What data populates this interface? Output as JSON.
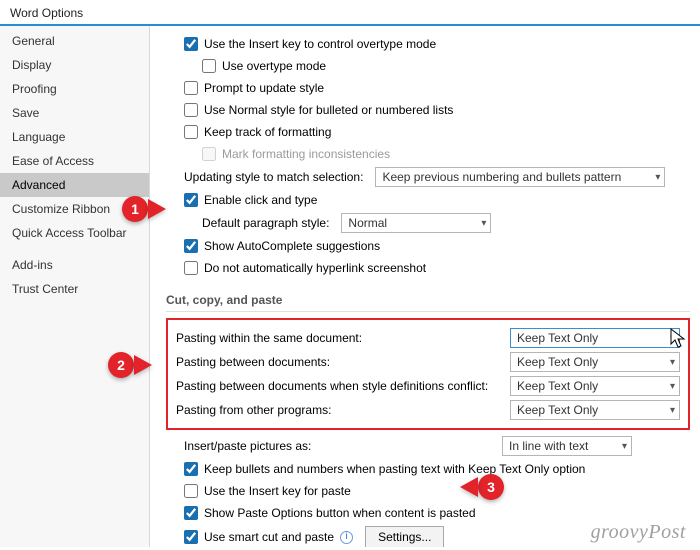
{
  "window": {
    "title": "Word Options"
  },
  "sidebar": {
    "items": [
      {
        "label": "General"
      },
      {
        "label": "Display"
      },
      {
        "label": "Proofing"
      },
      {
        "label": "Save"
      },
      {
        "label": "Language"
      },
      {
        "label": "Ease of Access"
      },
      {
        "label": "Advanced",
        "selected": true
      },
      {
        "label": "Customize Ribbon"
      },
      {
        "label": "Quick Access Toolbar"
      },
      {
        "label": "Add-ins"
      },
      {
        "label": "Trust Center"
      }
    ]
  },
  "editing": {
    "insert_overtype": "Use the Insert key to control overtype mode",
    "use_overtype": "Use overtype mode",
    "prompt_update_style": "Prompt to update style",
    "normal_bulleted": "Use Normal style for bulleted or numbered lists",
    "keep_track_formatting": "Keep track of formatting",
    "mark_inconsistencies": "Mark formatting inconsistencies",
    "updating_style_label": "Updating style to match selection:",
    "updating_style_value": "Keep previous numbering and bullets pattern",
    "enable_click_type": "Enable click and type",
    "default_para_label": "Default paragraph style:",
    "default_para_value": "Normal",
    "autocomplete": "Show AutoComplete suggestions",
    "no_hyperlink_screenshot": "Do not automatically hyperlink screenshot"
  },
  "paste_section": {
    "header": "Cut, copy, and paste",
    "within": {
      "label": "Pasting within the same document:",
      "value": "Keep Text Only"
    },
    "between": {
      "label": "Pasting between documents:",
      "value": "Keep Text Only"
    },
    "between_conflict": {
      "label": "Pasting between documents when style definitions conflict:",
      "value": "Keep Text Only"
    },
    "other_programs": {
      "label": "Pasting from other programs:",
      "value": "Keep Text Only"
    },
    "insert_pictures_label": "Insert/paste pictures as:",
    "insert_pictures_value": "In line with text",
    "keep_bullets": "Keep bullets and numbers when pasting text with Keep Text Only option",
    "insert_key_paste": "Use the Insert key for paste",
    "show_paste_options": "Show Paste Options button when content is pasted",
    "smart_cut_paste": "Use smart cut and paste",
    "settings_button": "Settings..."
  },
  "callouts": {
    "1": "1",
    "2": "2",
    "3": "3"
  },
  "watermark": "groovyPost"
}
